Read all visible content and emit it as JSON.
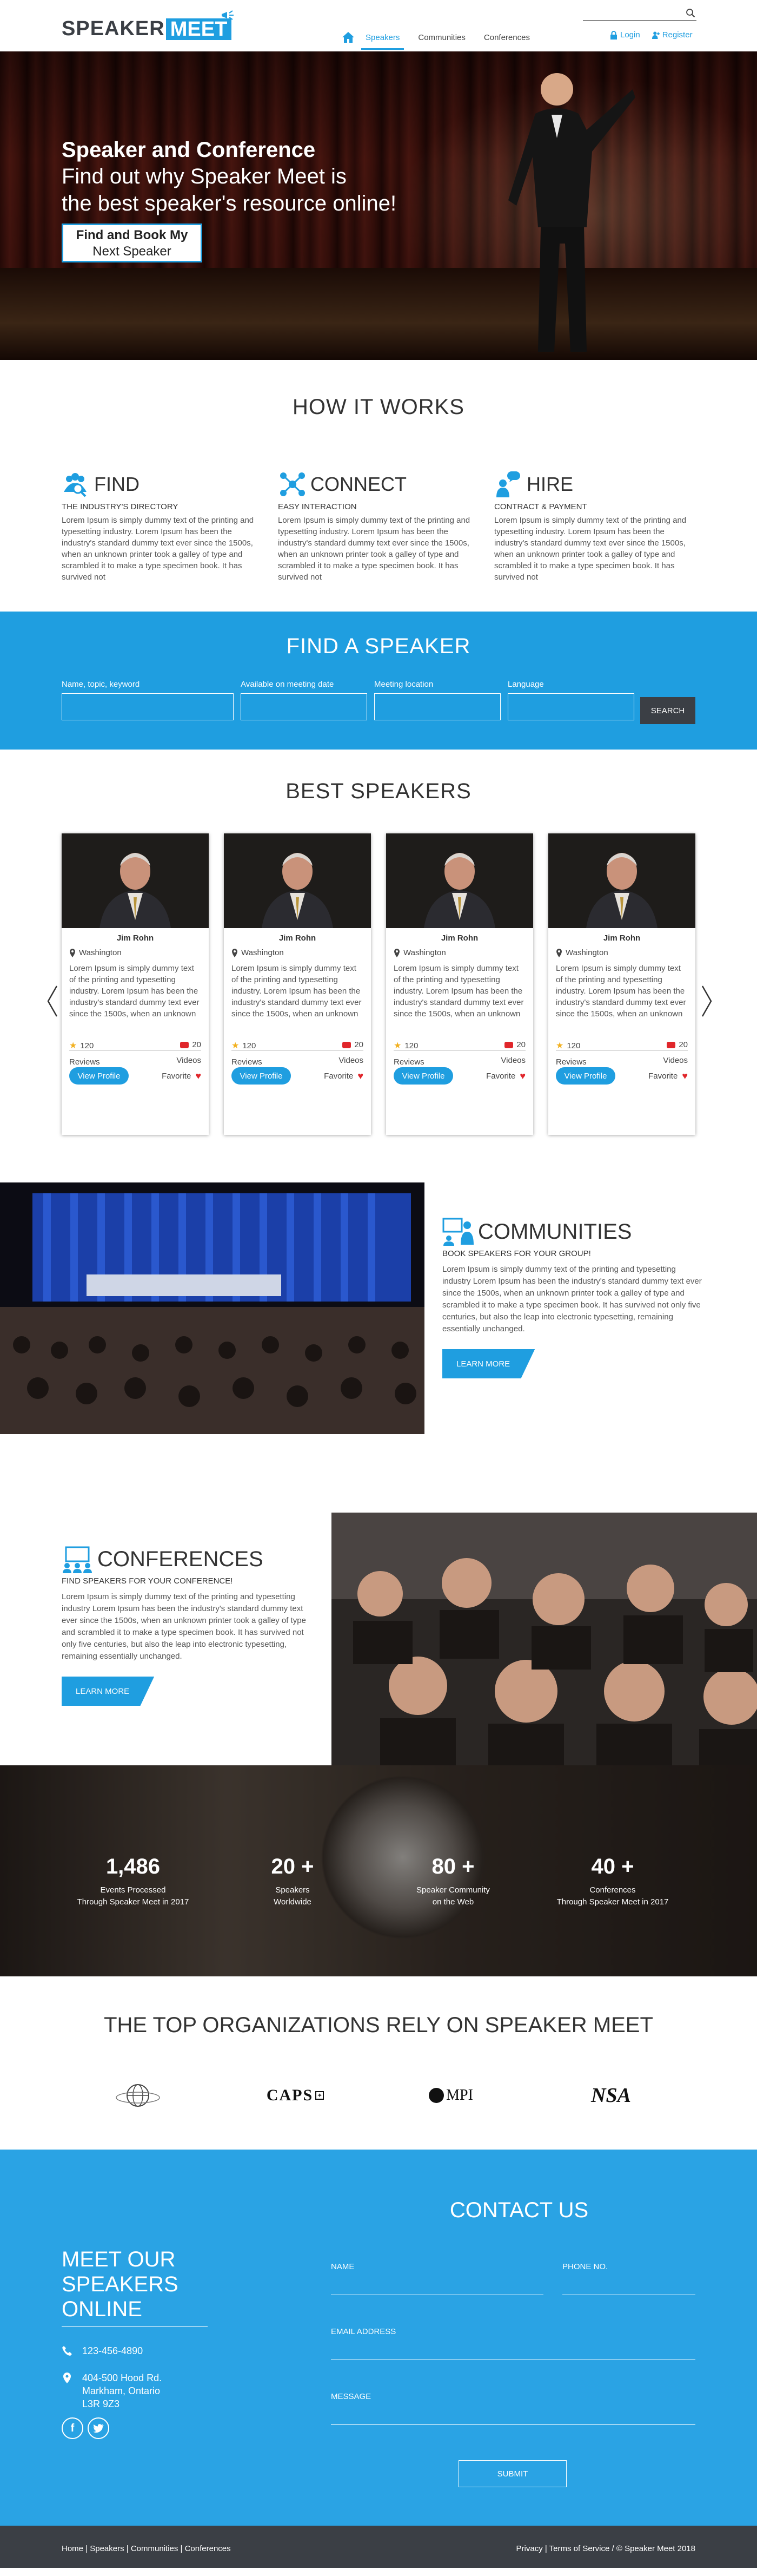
{
  "header": {
    "logo_word1": "SPEAKER",
    "logo_word2": "MEET",
    "search_placeholder": "",
    "nav": [
      "Speakers",
      "Communities",
      "Conferences"
    ],
    "login": "Login",
    "register": "Register"
  },
  "hero": {
    "title": "Speaker and Conference",
    "subtitle_line1": "Find out why Speaker Meet is",
    "subtitle_line2": "the best speaker's resource online!",
    "cta_line1": "Find and Book My",
    "cta_line2": "Next Speaker"
  },
  "how": {
    "title": "HOW IT WORKS",
    "columns": [
      {
        "icon": "group-search-icon",
        "heading": "FIND",
        "sub": "THE INDUSTRY'S DIRECTORY",
        "text": "Lorem Ipsum is simply dummy text of the printing and typesetting industry. Lorem Ipsum has been the industry's standard dummy text ever since the 1500s, when an unknown printer took a galley of type and scrambled it to make a type specimen book. It has survived not"
      },
      {
        "icon": "network-icon",
        "heading": "CONNECT",
        "sub": "EASY INTERACTION",
        "text": "Lorem Ipsum is simply dummy text of the printing and typesetting industry. Lorem Ipsum has been the industry's standard dummy text ever since the 1500s, when an unknown printer took a galley of type and scrambled it to make a type specimen book. It has survived not"
      },
      {
        "icon": "speech-person-icon",
        "heading": "HIRE",
        "sub": "CONTRACT & PAYMENT",
        "text": "Lorem Ipsum is simply dummy text of the printing and typesetting industry. Lorem Ipsum has been the industry's standard dummy text ever since the 1500s, when an unknown printer took a galley of type and scrambled it to make a type specimen book. It has survived not"
      }
    ]
  },
  "find": {
    "title": "FIND A SPEAKER",
    "fields": [
      "Name, topic, keyword",
      "Available on meeting date",
      "Meeting location",
      "Language"
    ],
    "search_label": "SEARCH"
  },
  "best": {
    "title": "BEST SPEAKERS",
    "cards": [
      {
        "name": "Jim Rohn",
        "location": "Washington",
        "bio": "Lorem Ipsum is simply dummy text of the printing and typesetting industry. Lorem Ipsum has been the industry's standard dummy text ever since the 1500s, when an unknown printer",
        "reviews": "120",
        "reviews_label": "Reviews",
        "videos": "20",
        "videos_label": "Videos",
        "view": "View Profile",
        "favorite": "Favorite"
      },
      {
        "name": "Jim Rohn",
        "location": "Washington",
        "bio": "Lorem Ipsum is simply dummy text of the printing and typesetting industry. Lorem Ipsum has been the industry's standard dummy text ever since the 1500s, when an unknown printer",
        "reviews": "120",
        "reviews_label": "Reviews",
        "videos": "20",
        "videos_label": "Videos",
        "view": "View Profile",
        "favorite": "Favorite"
      },
      {
        "name": "Jim Rohn",
        "location": "Washington",
        "bio": "Lorem Ipsum is simply dummy text of the printing and typesetting industry. Lorem Ipsum has been the industry's standard dummy text ever since the 1500s, when an unknown printer",
        "reviews": "120",
        "reviews_label": "Reviews",
        "videos": "20",
        "videos_label": "Videos",
        "view": "View Profile",
        "favorite": "Favorite"
      },
      {
        "name": "Jim Rohn",
        "location": "Washington",
        "bio": "Lorem Ipsum is simply dummy text of the printing and typesetting industry. Lorem Ipsum has been the industry's standard dummy text ever since the 1500s, when an unknown printer",
        "reviews": "120",
        "reviews_label": "Reviews",
        "videos": "20",
        "videos_label": "Videos",
        "view": "View Profile",
        "favorite": "Favorite"
      }
    ]
  },
  "communities": {
    "heading": "COMMUNITIES",
    "sub": "BOOK SPEAKERS FOR YOUR GROUP!",
    "text": "Lorem Ipsum is simply dummy text of the printing and typesetting industry Lorem Ipsum has been the industry's standard dummy text ever since the 1500s, when an unknown printer took a galley of type and scrambled it to make a type specimen book. It has survived not only five centuries, but also the leap into electronic typesetting, remaining essentially unchanged.",
    "button": "LEARN MORE"
  },
  "conferences": {
    "heading": "CONFERENCES",
    "sub": "FIND SPEAKERS FOR YOUR CONFERENCE!",
    "text": "Lorem Ipsum is simply dummy text of the printing and typesetting industry Lorem Ipsum has been the industry's standard dummy text ever since the 1500s, when an unknown printer took a galley of type and scrambled it to make a type specimen book. It has survived not only five centuries, but also the leap into electronic typesetting, remaining essentially unchanged.",
    "button": "LEARN MORE"
  },
  "stats": [
    {
      "number": "1,486",
      "line1": "Events Processed",
      "line2": "Through Speaker Meet in 2017"
    },
    {
      "number": "20 +",
      "line1": "Speakers",
      "line2": "Worldwide"
    },
    {
      "number": "80 +",
      "line1": "Speaker Community",
      "line2": "on the Web"
    },
    {
      "number": "40 +",
      "line1": "Conferences",
      "line2": "Through Speaker Meet in 2017"
    }
  ],
  "orgs": {
    "title": "THE TOP ORGANIZATIONS RELY ON SPEAKER MEET",
    "logos": [
      "CAPS",
      "MPI",
      "NSA"
    ]
  },
  "contact": {
    "meet_title": "MEET OUR SPEAKERS ONLINE",
    "phone": "123-456-4890",
    "address1": "404-500 Hood Rd.",
    "address2": "Markham, Ontario",
    "address3": "L3R 9Z3",
    "social_f": "f",
    "form_title": "CONTACT US",
    "name_label": "NAME",
    "phone_label": "PHONE NO.",
    "email_label": "EMAIL ADDRESS",
    "message_label": "MESSAGE",
    "submit": "SUBMIT"
  },
  "footer": {
    "left": "Home  |  Speakers  |  Communities  |  Conferences",
    "right": "Privacy | Terms of Service / © Speaker Meet 2018"
  },
  "colors": {
    "accent": "#1f9ee0",
    "dark": "#3b3f45"
  }
}
